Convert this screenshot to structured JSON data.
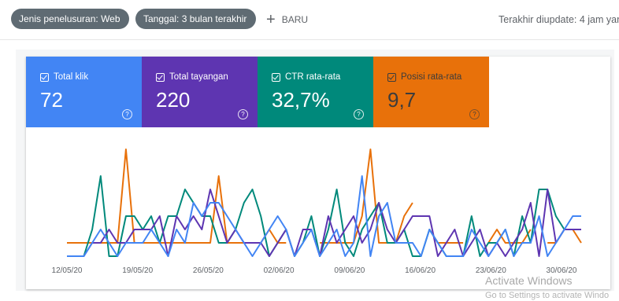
{
  "topbar": {
    "search_type_chip": "Jenis penelusuran: Web",
    "date_chip": "Tanggal: 3 bulan terakhir",
    "new_button": "BARU",
    "last_updated": "Terakhir diupdate: 4 jam yang"
  },
  "metrics": [
    {
      "label": "Total klik",
      "value": "72",
      "color": "#4285f4"
    },
    {
      "label": "Total tayangan",
      "value": "220",
      "color": "#5e35b1"
    },
    {
      "label": "CTR rata-rata",
      "value": "32,7%",
      "color": "#00897b"
    },
    {
      "label": "Posisi rata-rata",
      "value": "9,7",
      "color": "#e8710a"
    }
  ],
  "watermark": {
    "line1": "Activate Windows",
    "line2": "Go to Settings to activate Windo"
  },
  "chart_data": {
    "type": "line",
    "x_tick_labels": [
      "12/05/20",
      "19/05/20",
      "26/05/20",
      "02/06/20",
      "09/06/20",
      "16/06/20",
      "23/06/20",
      "30/06/20"
    ],
    "y_axis_visible": false,
    "grid": false,
    "series": [
      {
        "name": "Total klik",
        "color": "#4285f4",
        "values": [
          0,
          0,
          0,
          1,
          2,
          1,
          0,
          1,
          1,
          1,
          2,
          1,
          0,
          2,
          1,
          4,
          3,
          4,
          4,
          3,
          2,
          1,
          0,
          1,
          2,
          3,
          2,
          0,
          1,
          2,
          0,
          1,
          2,
          0,
          1,
          6,
          0,
          3,
          4,
          1,
          1,
          1,
          0,
          2,
          1,
          0,
          0,
          0,
          2,
          1,
          0,
          1,
          2,
          0,
          1,
          1,
          3,
          0,
          1,
          2,
          3,
          3
        ]
      },
      {
        "name": "Total tayangan",
        "color": "#5e35b1",
        "values": [
          0,
          0,
          0,
          1,
          1,
          2,
          1,
          1,
          2,
          2,
          2,
          3,
          0,
          3,
          2,
          3,
          2,
          5,
          3,
          1,
          2,
          1,
          1,
          1,
          0,
          1,
          2,
          0,
          2,
          2,
          0,
          3,
          1,
          2,
          3,
          1,
          2,
          4,
          2,
          1,
          2,
          3,
          3,
          3,
          0,
          1,
          2,
          0,
          1,
          2,
          0,
          1,
          0,
          1,
          2,
          4,
          0,
          5,
          1,
          2,
          2,
          2
        ]
      },
      {
        "name": "CTR rata-rata",
        "color": "#00897b",
        "values": [
          0,
          0,
          0,
          2,
          6,
          0,
          0,
          3,
          3,
          2,
          3,
          1,
          3,
          3,
          5,
          4,
          3,
          3,
          1,
          1,
          2,
          4,
          5,
          3,
          0,
          1,
          2,
          0,
          1,
          3,
          0,
          2,
          5,
          1,
          0,
          2,
          3,
          4,
          1,
          1,
          2,
          0,
          0,
          2,
          1,
          0,
          0,
          0,
          3,
          0,
          1,
          1,
          2,
          0,
          3,
          1,
          5,
          5,
          3,
          2,
          2,
          2
        ]
      },
      {
        "name": "Posisi rata-rata",
        "color": "#e8710a",
        "values": [
          1,
          1,
          1,
          1,
          1,
          1,
          1,
          8,
          1,
          1,
          1,
          1,
          1,
          1,
          1,
          1,
          1,
          1,
          6,
          1,
          1,
          1,
          1,
          1,
          2,
          1,
          1,
          null,
          null,
          null,
          1,
          1,
          1,
          1,
          1,
          3,
          8,
          1,
          1,
          1,
          3,
          4,
          null,
          2,
          1,
          1,
          1,
          1,
          null,
          null,
          1,
          2,
          1,
          1,
          1,
          2,
          null,
          1,
          1,
          2,
          2,
          1
        ]
      }
    ]
  }
}
